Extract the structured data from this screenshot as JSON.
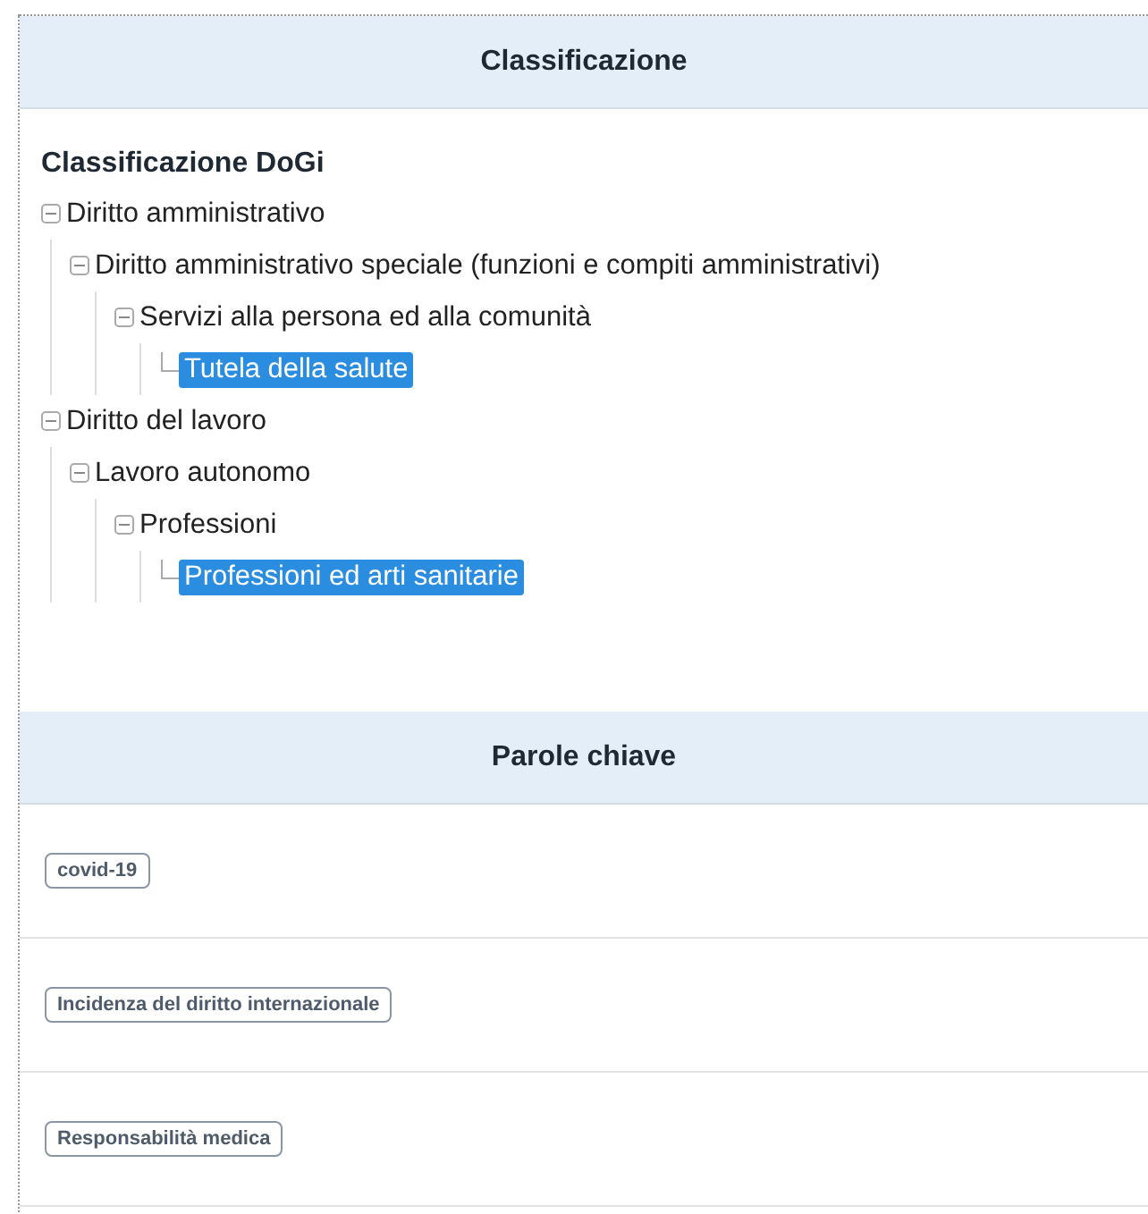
{
  "classification": {
    "heading": "Classificazione",
    "title": "Classificazione DoGi",
    "tree": [
      {
        "label": "Diritto amministrativo",
        "expanded": true,
        "selected": false,
        "children": [
          {
            "label": "Diritto amministrativo speciale (funzioni e compiti amministrativi)",
            "expanded": true,
            "selected": false,
            "children": [
              {
                "label": "Servizi alla persona ed alla comunità",
                "expanded": true,
                "selected": false,
                "children": [
                  {
                    "label": "Tutela della salute",
                    "selected": true
                  }
                ]
              }
            ]
          }
        ]
      },
      {
        "label": "Diritto del lavoro",
        "expanded": true,
        "selected": false,
        "children": [
          {
            "label": "Lavoro autonomo",
            "expanded": true,
            "selected": false,
            "children": [
              {
                "label": "Professioni",
                "expanded": true,
                "selected": false,
                "children": [
                  {
                    "label": "Professioni ed arti sanitarie",
                    "selected": true
                  }
                ]
              }
            ]
          }
        ]
      }
    ]
  },
  "keywords": {
    "heading": "Parole chiave",
    "tags": [
      "covid-19",
      "Incidenza del diritto internazionale",
      "Responsabilità medica"
    ]
  }
}
